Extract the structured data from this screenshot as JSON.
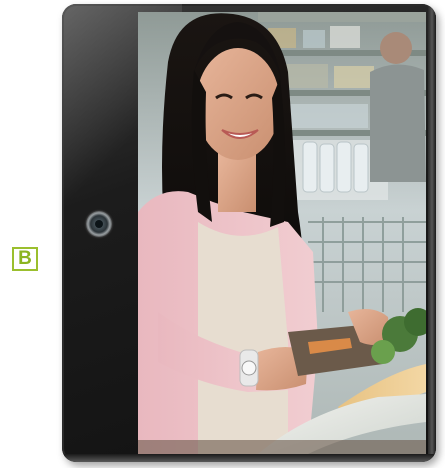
{
  "option": {
    "label": "B"
  },
  "colors": {
    "label_accent": "#8bb420",
    "device_body": "#1c1c1c"
  },
  "device": {
    "type": "tablet",
    "photo_subject": "woman-shopping-grocery-photo"
  }
}
